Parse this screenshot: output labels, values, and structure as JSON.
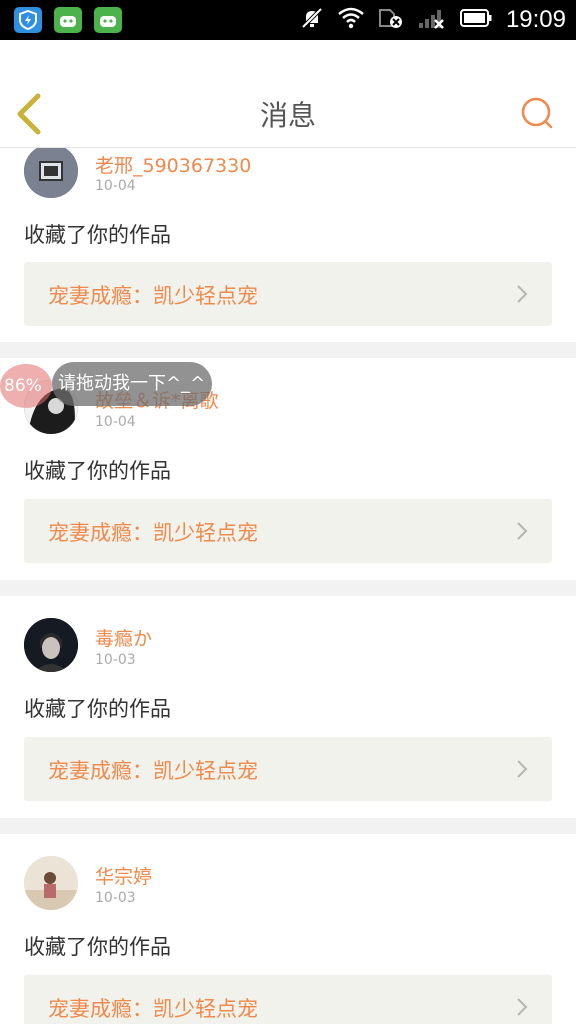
{
  "status_bar": {
    "time": "19:09",
    "icons": [
      "shield-app-icon",
      "android-app-icon",
      "android-app-icon",
      "mute-icon",
      "wifi-icon",
      "sim-off-icon",
      "signal-icon",
      "battery-icon"
    ]
  },
  "header": {
    "title": "消息",
    "back_icon": "chevron-left-icon",
    "search_icon": "search-icon",
    "accent_color": "#f0894b"
  },
  "floating_helper": {
    "percent": "86%",
    "hint": "请拖动我一下^_^"
  },
  "messages": [
    {
      "username": "老邢_590367330",
      "date": "10-04",
      "action": "收藏了你的作品",
      "work_title": "宠妻成瘾：凯少轻点宠"
    },
    {
      "username": "故垒＆诉*离歌",
      "date": "10-04",
      "action": "收藏了你的作品",
      "work_title": "宠妻成瘾：凯少轻点宠"
    },
    {
      "username": "毒瘾か",
      "date": "10-03",
      "action": "收藏了你的作品",
      "work_title": "宠妻成瘾：凯少轻点宠"
    },
    {
      "username": "华宗婷",
      "date": "10-03",
      "action": "收藏了你的作品",
      "work_title": "宠妻成瘾：凯少轻点宠"
    }
  ]
}
